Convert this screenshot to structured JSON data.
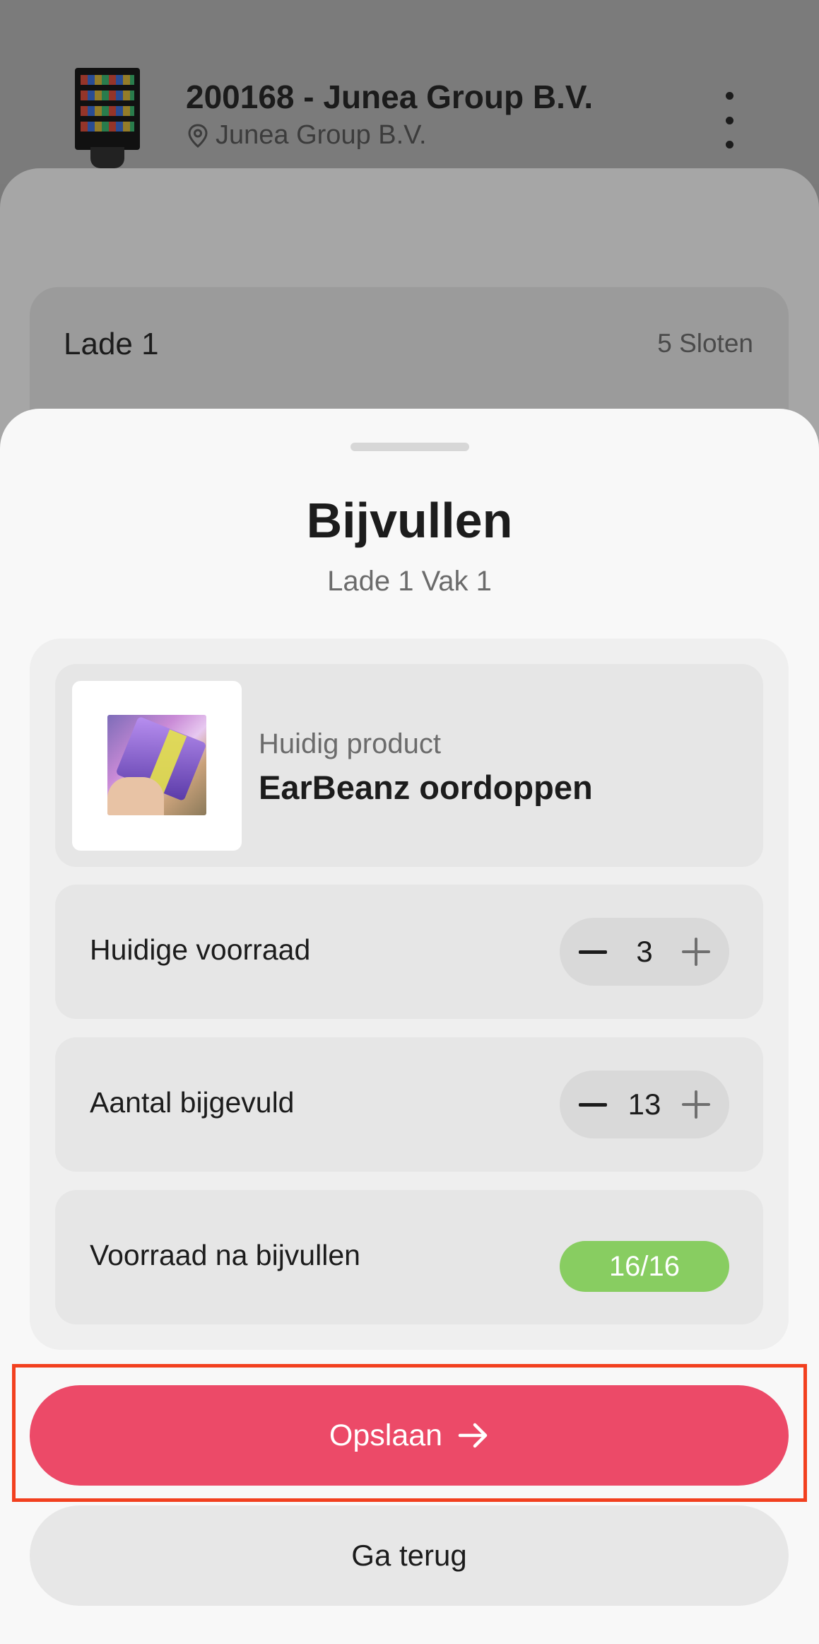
{
  "background": {
    "machine_title": "200168 - Junea Group B.V.",
    "location": "Junea Group B.V.",
    "drawer": {
      "title": "Lade 1",
      "slots": "5 Sloten"
    }
  },
  "sheet": {
    "title": "Bijvullen",
    "subtitle": "Lade 1 Vak 1",
    "product": {
      "label": "Huidig product",
      "name": "EarBeanz oordoppen"
    },
    "current_stock": {
      "label": "Huidige voorraad",
      "value": "3"
    },
    "refilled": {
      "label": "Aantal bijgevuld",
      "value": "13"
    },
    "after_refill": {
      "label": "Voorraad na bijvullen",
      "value": "16/16",
      "color": "#88cd61"
    },
    "save_label": "Opslaan",
    "back_label": "Ga terug"
  },
  "colors": {
    "primary": "#ec4a68",
    "highlight": "#f2401f"
  }
}
